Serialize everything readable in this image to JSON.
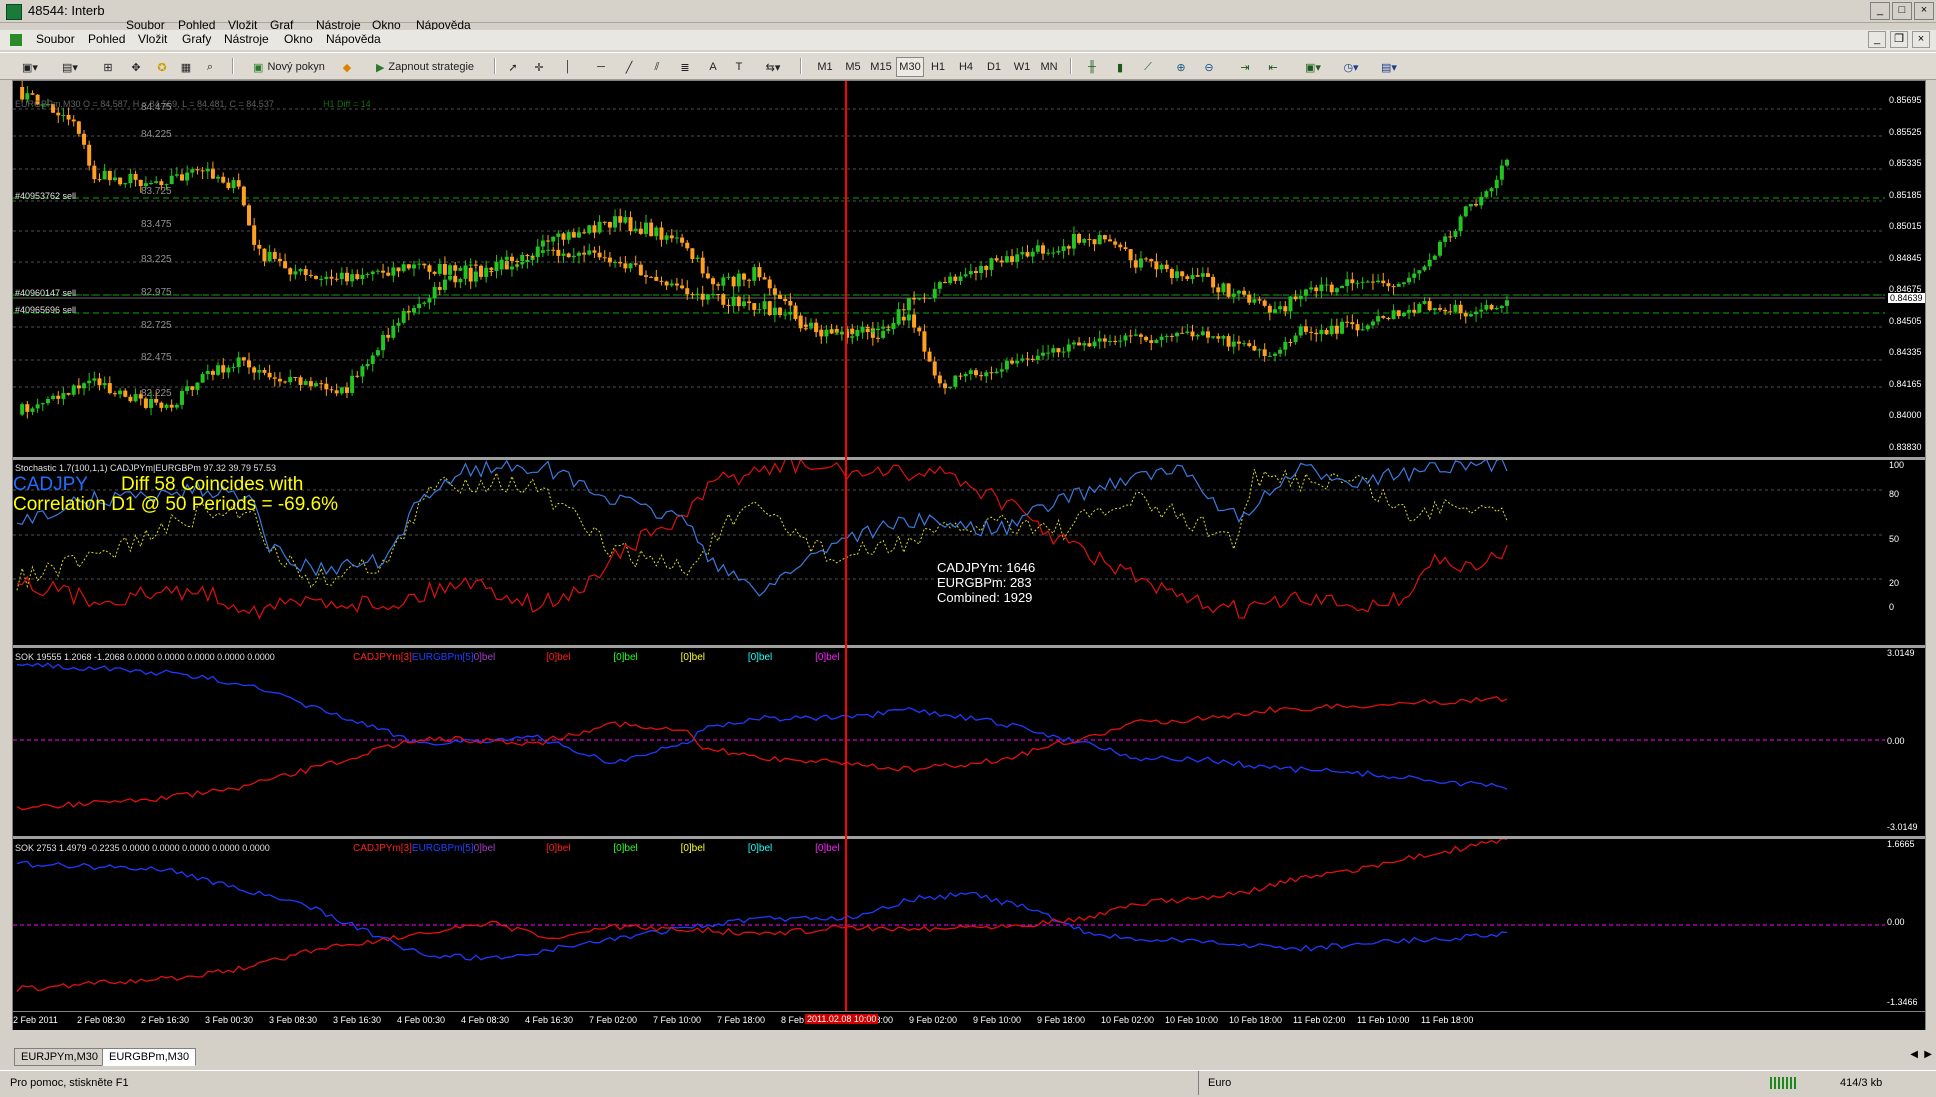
{
  "window": {
    "title": "48544: Interb",
    "controls": [
      "_",
      "□",
      "×"
    ]
  },
  "menu_top": [
    "Soubor",
    "Pohled",
    "Vložit",
    "Graf",
    "Nástroje",
    "Okno",
    "Nápověda"
  ],
  "menu": [
    "Soubor",
    "Pohled",
    "Vložit",
    "Grafy",
    "Nástroje",
    "Okno",
    "Nápověda"
  ],
  "toolbar": {
    "new_order": "Nový pokyn",
    "strategies": "Zapnout strategie",
    "timeframes": [
      "M1",
      "M5",
      "M15",
      "M30",
      "H1",
      "H4",
      "D1",
      "W1",
      "MN"
    ],
    "active_timeframe": "M30"
  },
  "main_chart": {
    "ohlc": "EURGBPm,M30 O = 84.587, H = 84.569, L = 84.481, C = 84.537",
    "h1_diff": "H1 Diff = 14",
    "left_scale": [
      "84.475",
      "84.225",
      "83.725",
      "83.475",
      "83.225",
      "82.975",
      "82.725",
      "82.475",
      "82.225"
    ],
    "right_scale": [
      "0.85695",
      "0.85525",
      "0.85335",
      "0.85185",
      "0.85015",
      "0.84845",
      "0.84675",
      "0.84505",
      "0.84335",
      "0.84165",
      "0.84000",
      "0.83830"
    ],
    "current_price": "0.84639",
    "orders": [
      "#40953762 sell",
      "#40960147 sell",
      "#40965696 sell"
    ]
  },
  "stoch_pane": {
    "header": "Stochastic 1.7(100,1,1) CADJPYm|EURGBPm 97.32 39.79 57.53",
    "symbol": "CADJPY",
    "diff_text": "Diff 58 Coincides with",
    "correlation": "Correlation D1 @ 50 Periods = -69.6%",
    "info_line1": "CADJPYm: 1646",
    "info_line2": "EURGBPm: 283",
    "info_line3": "Combined: 1929",
    "scale": [
      "100",
      "80",
      "50",
      "20",
      "0"
    ]
  },
  "sok1": {
    "header": "SOK 19555 1.2068 -1.2068 0.0000 0.0000 0.0000 0.0000 0.0000",
    "labels": [
      "CADJPYm[3]",
      "EURGBPm[5]",
      "0]bel",
      "[0]bel",
      "[0]bel",
      "[0]bel",
      "[0]bel",
      "[0]bel"
    ],
    "scale_top": "3.0149",
    "scale_mid": "0.00",
    "scale_bot": "-3.0149"
  },
  "sok2": {
    "header": "SOK 2753 1.4979 -0.2235 0.0000 0.0000 0.0000 0.0000 0.0000",
    "labels": [
      "CADJPYm[3]",
      "EURGBPm[5]",
      "0]bel",
      "[0]bel",
      "[0]bel",
      "[0]bel",
      "[0]bel",
      "[0]bel"
    ],
    "scale_top": "1.6665",
    "scale_mid": "0.00",
    "scale_bot": "-1.3466"
  },
  "time_axis": [
    "2 Feb 2011",
    "2 Feb 08:30",
    "2 Feb 16:30",
    "3 Feb 00:30",
    "3 Feb 08:30",
    "3 Feb 16:30",
    "4 Feb 00:30",
    "4 Feb 08:30",
    "4 Feb 16:30",
    "7 Feb 02:00",
    "7 Feb 10:00",
    "7 Feb 18:00",
    "8 Feb",
    "8 Feb 18:00",
    "9 Feb 02:00",
    "9 Feb 10:00",
    "9 Feb 18:00",
    "10 Feb 02:00",
    "10 Feb 10:00",
    "10 Feb 18:00",
    "11 Feb 02:00",
    "11 Feb 10:00",
    "11 Feb 18:00"
  ],
  "cursor_time": "2011.02.08 10:00",
  "tabs": [
    "EURJPYm,M30",
    "EURGBPm,M30"
  ],
  "active_tab": "EURGBPm,M30",
  "status": {
    "help": "Pro pomoc, stiskněte F1",
    "profile": "Euro",
    "traffic": "414/3 kb"
  },
  "colors": {
    "bull": "#22c322",
    "bear": "#ffa020",
    "cadjpy": "#1f3aff",
    "eurgbp": "#e01010",
    "stoch_blue": "#3a7ae0",
    "stoch_yellow": "#dede20",
    "cursor": "#ff0000",
    "grid": "#a0a0a0",
    "order_line": "#00b000",
    "zero_line": "#ff00ff"
  }
}
